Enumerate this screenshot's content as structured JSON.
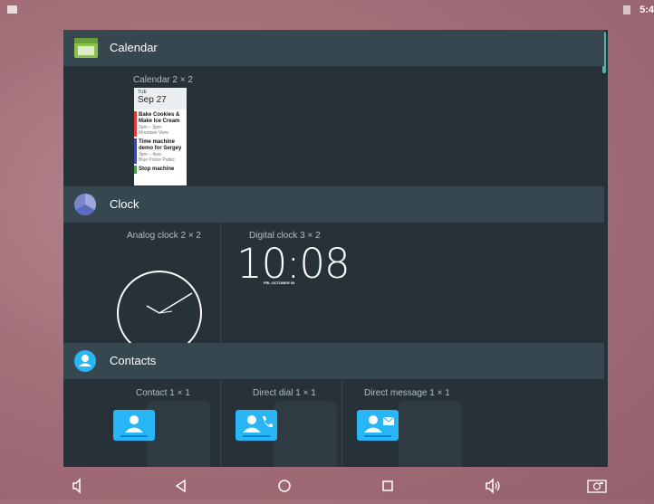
{
  "status": {
    "time": "5:4"
  },
  "sections": [
    {
      "title": "Calendar",
      "icon": "calendar-icon"
    },
    {
      "title": "Clock",
      "icon": "clock-icon"
    },
    {
      "title": "Contacts",
      "icon": "contacts-icon"
    }
  ],
  "calendar": {
    "widget_label": "Calendar 2 × 2",
    "day": "TUE",
    "date": "Sep 27",
    "events": [
      {
        "title": "Bake Cookies & Make Ice Cream",
        "time": "2pm – 3pm",
        "place": "Mountain View",
        "color": "#e53935"
      },
      {
        "title": "Time machine demo for Sergey",
        "time": "3pm – 4pm",
        "place": "Blue Police Public",
        "color": "#3949ab"
      },
      {
        "title": "Stop machine",
        "time": "",
        "place": "",
        "color": "#43a047"
      }
    ]
  },
  "clock": {
    "analog_label": "Analog clock 2 × 2",
    "digital_label": "Digital clock 3 × 2",
    "digital_time": "10:08",
    "digital_date": "FRI, OCTOBER 03"
  },
  "contacts": {
    "items": [
      {
        "label": "Contact 1 × 1",
        "icon": "person-icon"
      },
      {
        "label": "Direct dial 1 × 1",
        "icon": "person-phone-icon"
      },
      {
        "label": "Direct message 1 × 1",
        "icon": "person-message-icon"
      }
    ]
  },
  "navbar": [
    "volume-down-icon",
    "back-icon",
    "home-icon",
    "recents-icon",
    "volume-up-icon",
    "screenshot-icon"
  ],
  "colors": {
    "accent": "#4db6ac",
    "contact_blue": "#29b6f6",
    "panel_bg": "#263238",
    "header_bg": "#37474f"
  }
}
